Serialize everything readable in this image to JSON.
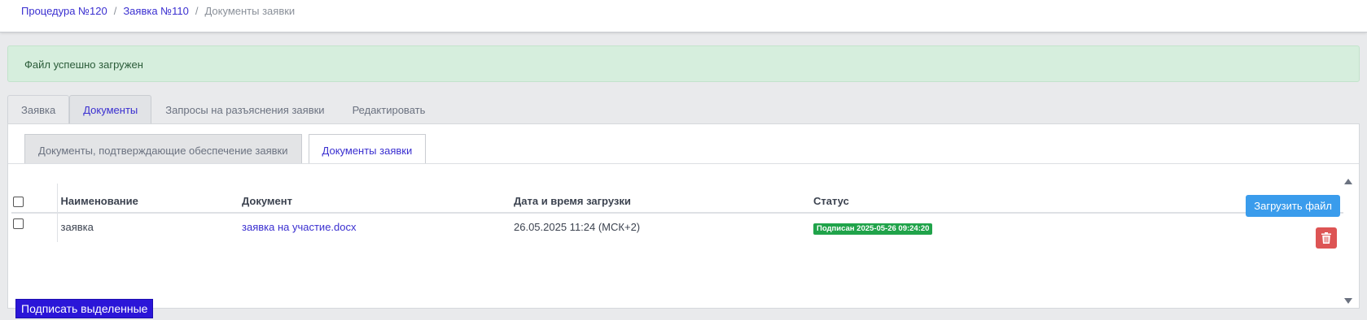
{
  "breadcrumb": {
    "item1": "Процедура №120",
    "item2": "Заявка №110",
    "current": "Документы заявки",
    "separator": "/"
  },
  "alert": {
    "message": "Файл успешно загружен"
  },
  "tabs": [
    "Заявка",
    "Документы",
    "Запросы на разъяснения заявки",
    "Редактировать"
  ],
  "subtabs": [
    "Документы, подтверждающие обеспечение заявки",
    "Документы заявки"
  ],
  "table": {
    "headers": [
      "Наименование",
      "Документ",
      "Дата и время загрузки",
      "Статус"
    ],
    "rows": [
      {
        "name": "заявка",
        "document": "заявка на участие.docx",
        "uploaded": "26.05.2025 11:24 (МСК+2)",
        "status": "Подписан 2025-05-26 09:24:20"
      }
    ]
  },
  "actions": {
    "upload_label": "Загрузить файл",
    "sign_selected_label": "Подписать выделенные"
  },
  "colors": {
    "accent": "#3a2fd0",
    "success_badge": "#20a34a",
    "upload_button": "#3a9cec",
    "delete_button": "#dd5454",
    "sign_button": "#2b16d8"
  },
  "icons": {
    "delete": "trash-icon",
    "scroll_up": "scroll-up-arrow-icon",
    "scroll_down": "scroll-down-arrow-icon"
  }
}
